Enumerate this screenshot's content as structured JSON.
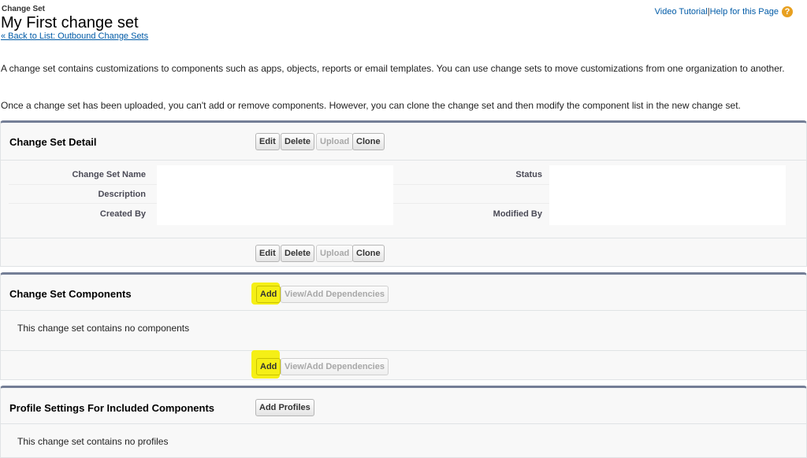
{
  "header": {
    "pretitle": "Change Set",
    "title": "My First change set",
    "back_link": "« Back to List: Outbound Change Sets",
    "video_tutorial": "Video Tutorial",
    "separator": " | ",
    "help_link": "Help for this Page",
    "help_icon": "help-icon"
  },
  "intro": {
    "p1": "A change set contains customizations to components such as apps, objects, reports or email templates. You can use change sets to move customizations from one organization to another.",
    "p2": "Once a change set has been uploaded, you can't add or remove components. However, you can clone the change set and then modify the component list in the new change set."
  },
  "detail": {
    "title": "Change Set Detail",
    "buttons": {
      "edit": "Edit",
      "delete": "Delete",
      "upload": "Upload",
      "clone": "Clone"
    },
    "fields": {
      "name_label": "Change Set Name",
      "description_label": "Description",
      "created_by_label": "Created By",
      "status_label": "Status",
      "modified_by_label": "Modified By"
    }
  },
  "components": {
    "title": "Change Set Components",
    "add": "Add",
    "view_add_dependencies": "View/Add Dependencies",
    "empty": "This change set contains no components",
    "highlight_color": "#f5ef16"
  },
  "profiles": {
    "title": "Profile Settings For Included Components",
    "add_profiles": "Add Profiles",
    "empty": "This change set contains no profiles"
  }
}
